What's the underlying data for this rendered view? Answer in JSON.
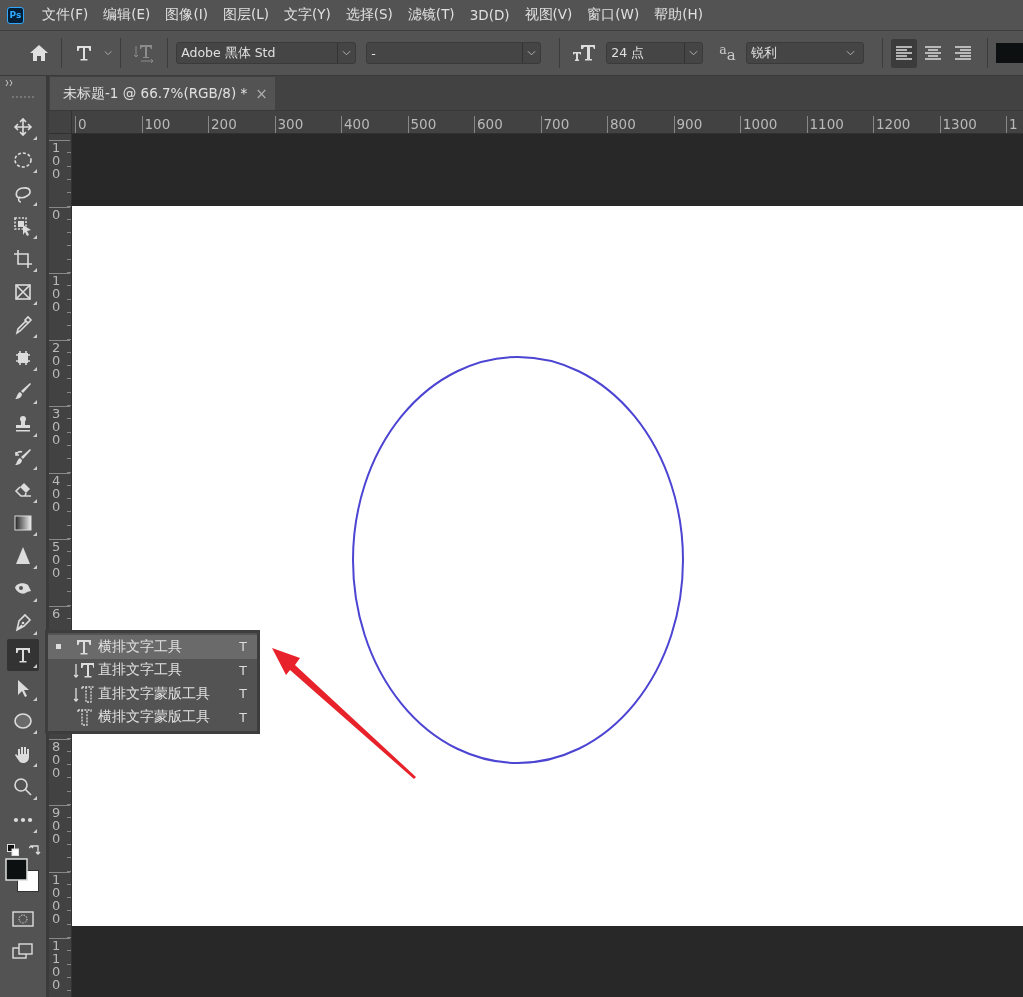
{
  "menu_bar": {
    "logo": "Ps",
    "items": [
      "文件(F)",
      "编辑(E)",
      "图像(I)",
      "图层(L)",
      "文字(Y)",
      "选择(S)",
      "滤镜(T)",
      "3D(D)",
      "视图(V)",
      "窗口(W)",
      "帮助(H)"
    ]
  },
  "options_bar": {
    "font_family": {
      "value": "Adobe 黑体 Std"
    },
    "font_style": {
      "value": "-"
    },
    "font_size": {
      "value": "24 点"
    },
    "antialias_icon": "$^{a}$a",
    "antialias": {
      "value": "锐利"
    },
    "align": [
      {
        "kind": "left",
        "selected": true
      },
      {
        "kind": "center",
        "selected": false
      },
      {
        "kind": "right",
        "selected": false
      }
    ]
  },
  "document_tab": {
    "title": "未标题-1 @ 66.7%(RGB/8) *",
    "close": "×"
  },
  "ruler_top": {
    "labels": [
      "0",
      "100",
      "200",
      "300",
      "400",
      "500",
      "600",
      "700",
      "800",
      "900",
      "1000",
      "1100",
      "1200",
      "1300",
      "1"
    ]
  },
  "ruler_left": {
    "labels": [
      "100",
      "0",
      "100",
      "200",
      "300",
      "400",
      "500",
      "6"
    ],
    "labels_below_flyout": [
      "800",
      "900",
      "1000",
      "1100"
    ]
  },
  "toolbar": {
    "tools": [
      {
        "kind": "move",
        "selected": false
      },
      {
        "kind": "marquee",
        "selected": false
      },
      {
        "kind": "lasso",
        "selected": false
      },
      {
        "kind": "object-select",
        "selected": false
      },
      {
        "kind": "crop",
        "selected": false
      },
      {
        "kind": "frame",
        "selected": false
      },
      {
        "kind": "eyedropper",
        "selected": false
      },
      {
        "kind": "heal",
        "selected": false
      },
      {
        "kind": "brush",
        "selected": false
      },
      {
        "kind": "stamp",
        "selected": false
      },
      {
        "kind": "history-brush",
        "selected": false
      },
      {
        "kind": "eraser",
        "selected": false
      },
      {
        "kind": "gradient",
        "selected": false
      },
      {
        "kind": "blur",
        "selected": false
      },
      {
        "kind": "dodge",
        "selected": false
      },
      {
        "kind": "pen",
        "selected": false
      },
      {
        "kind": "type",
        "selected": true
      },
      {
        "kind": "path-select",
        "selected": false
      },
      {
        "kind": "ellipse",
        "selected": false
      },
      {
        "kind": "hand",
        "selected": false
      },
      {
        "kind": "zoom",
        "selected": false
      },
      {
        "kind": "more",
        "selected": false
      }
    ]
  },
  "flyout": {
    "items": [
      {
        "kind": "horizontal-type",
        "label": "横排文字工具",
        "shortcut": "T",
        "selected": true
      },
      {
        "kind": "vertical-type",
        "label": "直排文字工具",
        "shortcut": "T",
        "selected": false
      },
      {
        "kind": "vertical-mask",
        "label": "直排文字蒙版工具",
        "shortcut": "T",
        "selected": false
      },
      {
        "kind": "horizontal-mask",
        "label": "横排文字蒙版工具",
        "shortcut": "T",
        "selected": false
      }
    ]
  }
}
